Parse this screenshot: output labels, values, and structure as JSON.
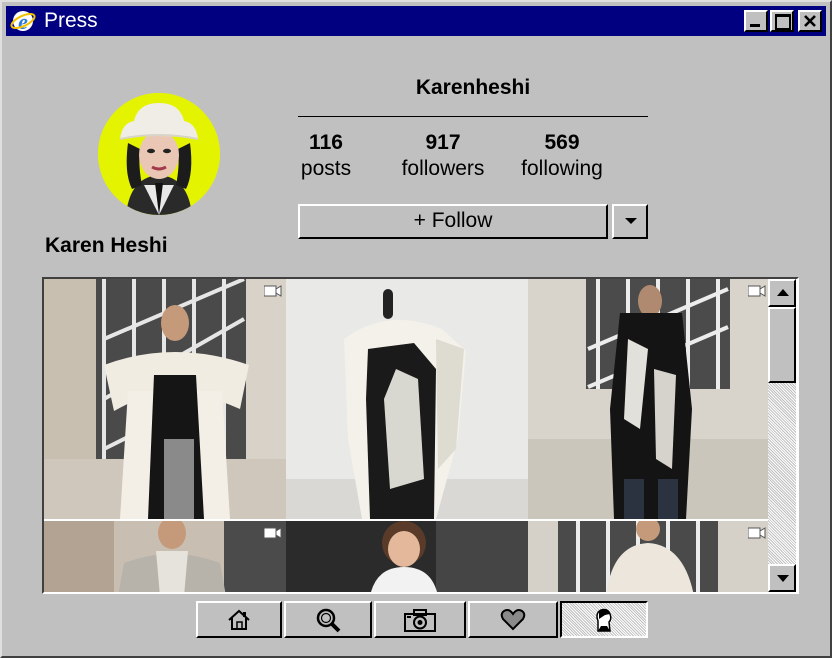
{
  "window": {
    "title": "Press"
  },
  "profile": {
    "username": "Karenheshi",
    "display_name": "Karen Heshi",
    "avatar_bg": "#e4f400",
    "stats": [
      {
        "value": "116",
        "label": "posts"
      },
      {
        "value": "917",
        "label": "followers"
      },
      {
        "value": "569",
        "label": "following"
      }
    ],
    "follow_label": "+ Follow"
  },
  "posts": [
    {
      "type": "video",
      "icon": "video-camera-icon"
    },
    {
      "type": "photo",
      "icon": ""
    },
    {
      "type": "video",
      "icon": "video-camera-icon"
    },
    {
      "type": "video",
      "icon": "video-camera-icon"
    },
    {
      "type": "photo",
      "icon": ""
    },
    {
      "type": "video",
      "icon": "video-camera-icon"
    }
  ],
  "nav": [
    {
      "name": "home",
      "icon": "home-icon"
    },
    {
      "name": "search",
      "icon": "search-icon"
    },
    {
      "name": "camera",
      "icon": "camera-icon"
    },
    {
      "name": "activity",
      "icon": "heart-icon"
    },
    {
      "name": "profile",
      "icon": "profile-icon",
      "active": true
    }
  ],
  "colors": {
    "titlebar": "#000080",
    "window_bg": "#c0c0c0",
    "accent_yellow": "#e4f400"
  }
}
